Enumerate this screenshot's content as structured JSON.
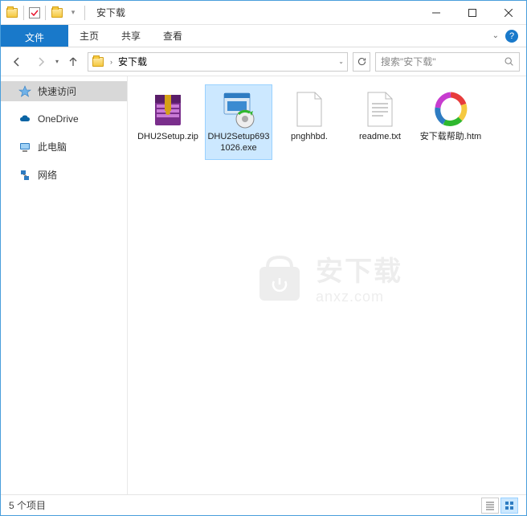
{
  "title": "安下载",
  "ribbon": {
    "file": "文件",
    "home": "主页",
    "share": "共享",
    "view": "查看"
  },
  "address": {
    "folder": "安下载"
  },
  "search": {
    "placeholder": "搜索\"安下载\""
  },
  "sidebar": {
    "items": [
      {
        "label": "快速访问",
        "icon": "star",
        "active": true
      },
      {
        "label": "OneDrive",
        "icon": "cloud"
      },
      {
        "label": "此电脑",
        "icon": "pc"
      },
      {
        "label": "网络",
        "icon": "network"
      }
    ]
  },
  "files": [
    {
      "name": "DHU2Setup.zip",
      "icon": "zip",
      "selected": false
    },
    {
      "name": "DHU2Setup6931026.exe",
      "icon": "exe",
      "selected": true
    },
    {
      "name": "pnghhbd.",
      "icon": "blank",
      "selected": false
    },
    {
      "name": "readme.txt",
      "icon": "txt",
      "selected": false
    },
    {
      "name": "安下载帮助.htm",
      "icon": "htm",
      "selected": false
    }
  ],
  "status": {
    "text": "5 个项目"
  },
  "watermark": {
    "zh": "安下载",
    "en": "anxz.com"
  }
}
